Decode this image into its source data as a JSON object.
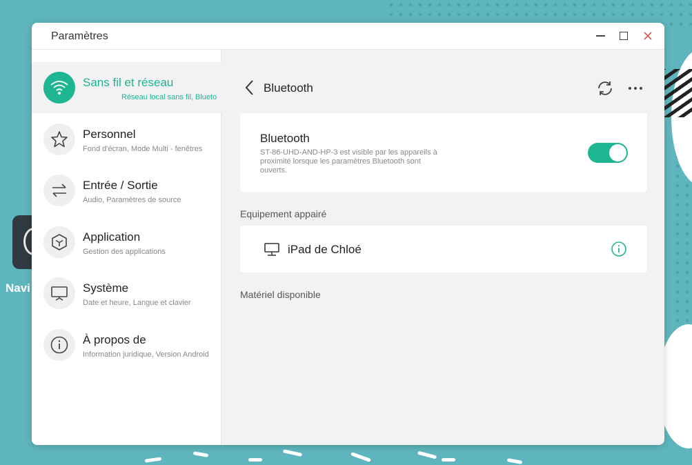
{
  "colors": {
    "accent": "#1eb592",
    "wallpaper": "#5fb5bd"
  },
  "desktop": {
    "app_label": "Navi"
  },
  "window": {
    "title": "Paramètres"
  },
  "sidebar": {
    "items": [
      {
        "icon": "wifi-icon",
        "title": "Sans fil et réseau",
        "subtitle": "Réseau local sans fil, Blueto",
        "active": true
      },
      {
        "icon": "star-icon",
        "title": "Personnel",
        "subtitle": "Fond d'écran, Mode Multi - fenêtres"
      },
      {
        "icon": "swap-arrows-icon",
        "title": "Entrée / Sortie",
        "subtitle": "Audio, Paramètres de source"
      },
      {
        "icon": "cube-icon",
        "title": "Application",
        "subtitle": "Gestion des applications"
      },
      {
        "icon": "monitor-icon",
        "title": "Système",
        "subtitle": "Date et heure, Langue et clavier"
      },
      {
        "icon": "info-icon",
        "title": "À propos de",
        "subtitle": "Information juridique, Version Android"
      }
    ]
  },
  "content": {
    "header_title": "Bluetooth",
    "bluetooth": {
      "title": "Bluetooth",
      "description": "ST-86-UHD-AND-HP-3 est visible par les appareils à proximité lorsque les paramètres Bluetooth sont ouverts.",
      "enabled": true
    },
    "paired_label": "Equipement appairé",
    "paired_devices": [
      {
        "name": "iPad de Chloé",
        "icon": "monitor-icon"
      }
    ],
    "available_label": "Matériel disponible"
  }
}
